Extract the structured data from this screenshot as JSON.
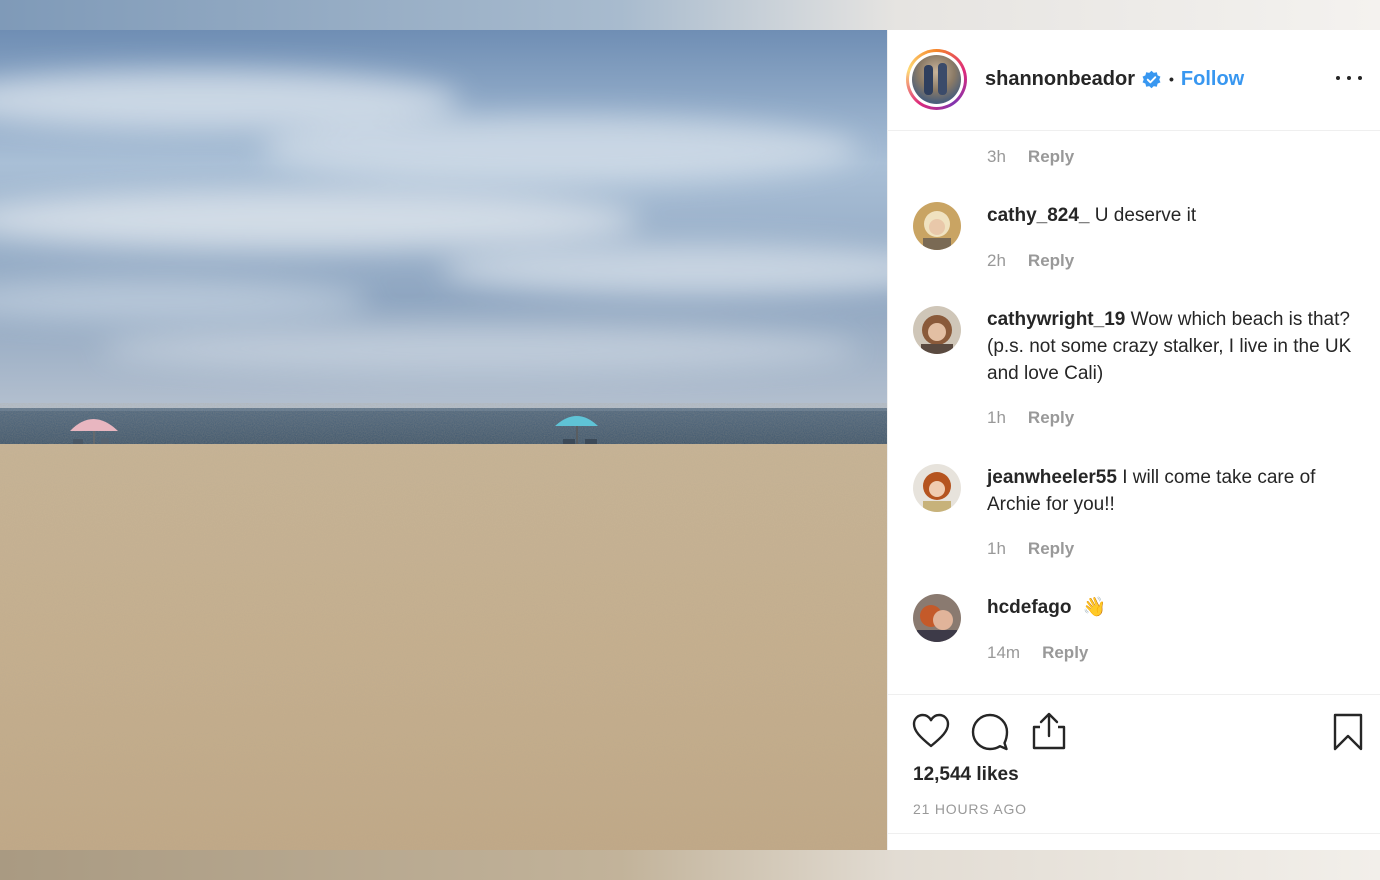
{
  "post": {
    "owner": "shannonbeador",
    "follow_label": "Follow",
    "separator": "•",
    "likes": "12,544 likes",
    "time_ago": "21 HOURS AGO"
  },
  "comments": [
    {
      "username": "",
      "text": "",
      "time": "3h",
      "reply": "Reply"
    },
    {
      "username": "cathy_824_",
      "text": "U deserve it",
      "time": "2h",
      "reply": "Reply"
    },
    {
      "username": "cathywright_19",
      "text": "Wow which beach is that? (p.s. not some crazy stalker, I live in the UK and love Cali)",
      "time": "1h",
      "reply": "Reply"
    },
    {
      "username": "jeanwheeler55",
      "text": "I will come take care of Archie for you!!",
      "time": "1h",
      "reply": "Reply"
    },
    {
      "username": "hcdefago",
      "text": "👋",
      "time": "14m",
      "reply": "Reply"
    }
  ],
  "icons": {
    "verified": "verified-badge-icon",
    "more": "more-options-icon",
    "like": "heart-icon",
    "comment": "comment-bubble-icon",
    "share": "share-icon",
    "save": "bookmark-icon"
  },
  "colors": {
    "accent": "#3897f0",
    "text": "#262626",
    "muted": "#999999"
  }
}
